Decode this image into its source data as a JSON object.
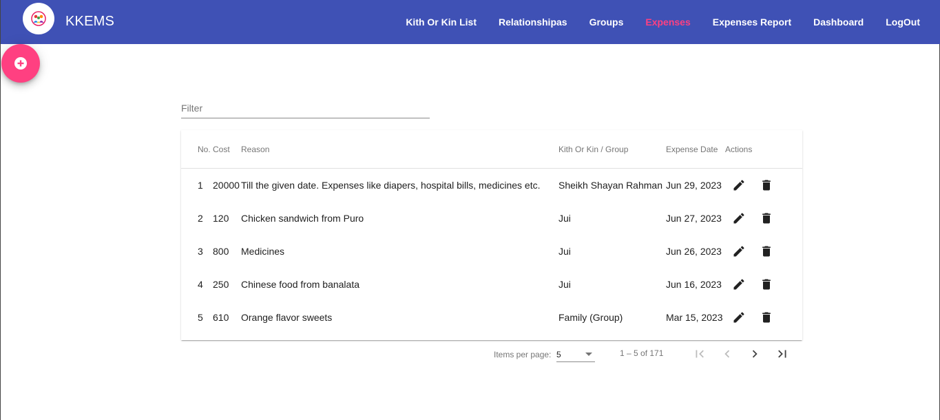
{
  "app": {
    "title": "KKEMS"
  },
  "nav": [
    {
      "label": "Kith Or Kin List",
      "active": false
    },
    {
      "label": "Relationshipas",
      "active": false
    },
    {
      "label": "Groups",
      "active": false
    },
    {
      "label": "Expenses",
      "active": true
    },
    {
      "label": "Expenses Report",
      "active": false
    },
    {
      "label": "Dashboard",
      "active": false
    },
    {
      "label": "LogOut",
      "active": false
    }
  ],
  "filter": {
    "placeholder": "Filter",
    "value": ""
  },
  "table": {
    "headers": {
      "no": "No.",
      "cost": "Cost",
      "reason": "Reason",
      "kith": "Kith Or Kin / Group",
      "date": "Expense Date",
      "actions": "Actions"
    },
    "rows": [
      {
        "no": "1",
        "cost": "20000",
        "reason": "Till the given date. Expenses like diapers, hospital bills, medicines etc.",
        "kith": "Sheikh Shayan Rahman",
        "date": "Jun 29, 2023"
      },
      {
        "no": "2",
        "cost": "120",
        "reason": "Chicken sandwich from Puro",
        "kith": "Jui",
        "date": "Jun 27, 2023"
      },
      {
        "no": "3",
        "cost": "800",
        "reason": "Medicines",
        "kith": "Jui",
        "date": "Jun 26, 2023"
      },
      {
        "no": "4",
        "cost": "250",
        "reason": "Chinese food from banalata",
        "kith": "Jui",
        "date": "Jun 16, 2023"
      },
      {
        "no": "5",
        "cost": "610",
        "reason": "Orange flavor sweets",
        "kith": "Family (Group)",
        "date": "Mar 15, 2023"
      }
    ]
  },
  "paginator": {
    "items_per_page_label": "Items per page:",
    "page_size": "5",
    "range": "1 – 5 of 171"
  },
  "icons": {
    "fab": "add-circle-icon",
    "edit": "pencil-icon",
    "delete": "trash-icon",
    "first": "first-page-icon",
    "prev": "chevron-left-icon",
    "next": "chevron-right-icon",
    "last": "last-page-icon"
  },
  "colors": {
    "primary": "#3f51b5",
    "accent": "#ff4081"
  }
}
